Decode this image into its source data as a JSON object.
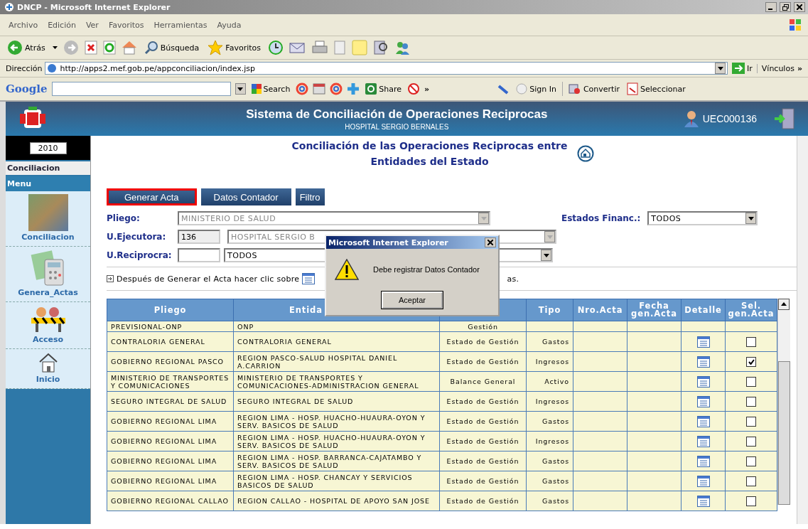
{
  "window": {
    "title": "DNCP - Microsoft Internet Explorer"
  },
  "menu_bar": [
    "Archivo",
    "Edición",
    "Ver",
    "Favoritos",
    "Herramientas",
    "Ayuda"
  ],
  "toolbar": {
    "back": "Atrás",
    "search": "Búsqueda",
    "favorites": "Favoritos"
  },
  "address_bar": {
    "label": "Dirección",
    "url": "http://apps2.mef.gob.pe/appconciliacion/index.jsp",
    "go": "Ir",
    "links": "Vínculos",
    "more": "»"
  },
  "google_toolbar": {
    "brand": "Google",
    "search": "Search",
    "share": "Share",
    "more": "»",
    "sign_in": "Sign In",
    "convert": "Convertir",
    "select": "Seleccionar"
  },
  "header": {
    "title": "Sistema de Conciliación de Operaciones Reciprocas",
    "subtitle": "HOSPITAL SERGIO BERNALES",
    "user": "UEC000136"
  },
  "sidebar": {
    "year": "2010",
    "section": "Conciliacion",
    "menu_label": "Menu",
    "items": [
      {
        "label": "Conciliacion"
      },
      {
        "label": "Genera_Actas"
      },
      {
        "label": "Acceso"
      },
      {
        "label": "Inicio"
      }
    ]
  },
  "page": {
    "title_lines": [
      "Conciliación de las Operaciones Reciprocas entre",
      "Entidades del Estado"
    ],
    "buttons": [
      {
        "label": "Generar Acta",
        "highlighted": true
      },
      {
        "label": "Datos Contador",
        "highlighted": false
      },
      {
        "label": "Filtro",
        "highlighted": false
      }
    ],
    "form": {
      "pliego": {
        "label": "Pliego:",
        "value": "MINISTERIO DE SALUD",
        "disabled": true
      },
      "estados": {
        "label": "Estados Financ.:",
        "value": "TODOS",
        "disabled": false
      },
      "ejecutora": {
        "label": "U.Ejecutora:",
        "code": "136",
        "value": "HOSPITAL SERGIO B",
        "disabled": true
      },
      "reciproca": {
        "label": "U.Reciprocra:",
        "value": "TODOS",
        "disabled": false
      }
    },
    "note": {
      "text": "Después de Generar el Acta hacer clic sobre",
      "tail": "as."
    },
    "table": {
      "columns": [
        {
          "label": "Pliego"
        },
        {
          "label": "Entida"
        },
        {},
        {
          "label": "Tipo"
        },
        {
          "label": "Nro.Acta"
        },
        {
          "label": "Fecha gen.Acta"
        },
        {
          "label": "Detalle"
        },
        {
          "label": "Sel. gen.Acta"
        }
      ],
      "rows": [
        {
          "pliego": "PREVISIONAL-ONP",
          "entidad": "ONP",
          "estado": "Gestión"
        },
        {
          "pliego": "CONTRALORIA GENERAL",
          "entidad": "CONTRALORIA GENERAL",
          "estado": "Estado de Gestión",
          "tipo": "Gastos",
          "checked": false
        },
        {
          "pliego": "GOBIERNO REGIONAL PASCO",
          "entidad": "REGION PASCO-SALUD HOSPITAL DANIEL A.CARRION",
          "estado": "Estado de Gestión",
          "tipo": "Ingresos",
          "checked": true
        },
        {
          "pliego": "MINISTERIO DE TRANSPORTES Y COMUNICACIONES",
          "entidad": "MINISTERIO DE TRANSPORTES Y COMUNICACIONES-ADMINISTRACION GENERAL",
          "estado": "Balance General",
          "tipo": "Activo",
          "checked": false
        },
        {
          "pliego": "SEGURO INTEGRAL DE SALUD",
          "entidad": "SEGURO INTEGRAL DE SALUD",
          "estado": "Estado de Gestión",
          "tipo": "Ingresos",
          "checked": false
        },
        {
          "pliego": "GOBIERNO REGIONAL LIMA",
          "entidad": "REGION LIMA - HOSP. HUACHO-HUAURA-OYON Y SERV. BASICOS DE SALUD",
          "estado": "Estado de Gestión",
          "tipo": "Gastos",
          "checked": false
        },
        {
          "pliego": "GOBIERNO REGIONAL LIMA",
          "entidad": "REGION LIMA - HOSP. HUACHO-HUAURA-OYON Y SERV. BASICOS DE SALUD",
          "estado": "Estado de Gestión",
          "tipo": "Ingresos",
          "checked": false
        },
        {
          "pliego": "GOBIERNO REGIONAL LIMA",
          "entidad": "REGION LIMA - HOSP. BARRANCA-CAJATAMBO Y SERV. BASICOS DE SALUD",
          "estado": "Estado de Gestión",
          "tipo": "Gastos",
          "checked": false
        },
        {
          "pliego": "GOBIERNO REGIONAL LIMA",
          "entidad": "REGION LIMA - HOSP. CHANCAY Y SERVICIOS BASICOS DE SALUD",
          "estado": "Estado de Gestión",
          "tipo": "Gastos",
          "checked": false
        },
        {
          "pliego": "GOBIERNO REGIONAL CALLAO",
          "entidad": "REGION CALLAO - HOSPITAL DE APOYO SAN JOSE",
          "estado": "Estado de Gestión",
          "tipo": "Gastos",
          "checked": false
        }
      ]
    },
    "dialog": {
      "title": "Microsoft Internet Explorer",
      "message": "Debe registrar Datos Contador",
      "button": "Aceptar"
    }
  }
}
